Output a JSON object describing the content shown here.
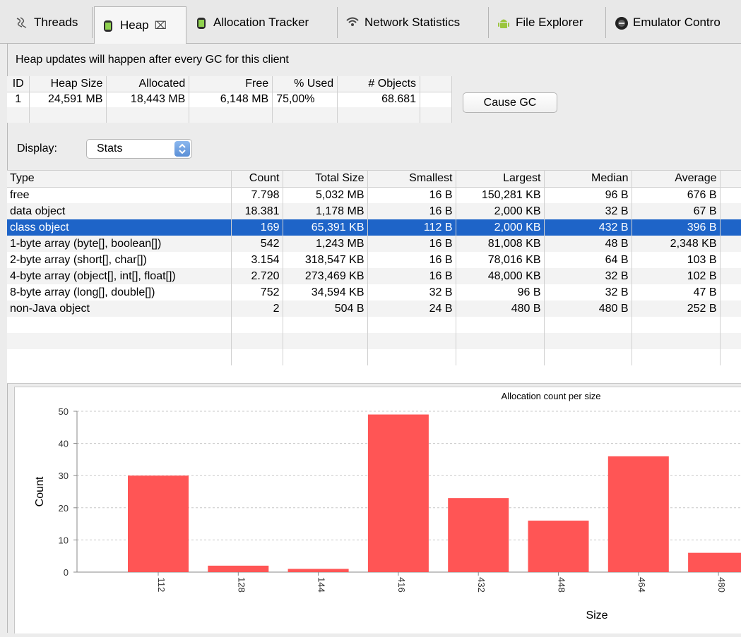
{
  "tabs": [
    {
      "label": "Threads",
      "icon": "threads-icon"
    },
    {
      "label": "Heap",
      "icon": "database-icon",
      "close": "⌧"
    },
    {
      "label": "Allocation Tracker",
      "icon": "database-icon"
    },
    {
      "label": "Network Statistics",
      "icon": "wifi-icon"
    },
    {
      "label": "File Explorer",
      "icon": "android-icon"
    },
    {
      "label": "Emulator Contro",
      "icon": "emulator-icon"
    }
  ],
  "heap": {
    "notice": "Heap updates will happen after every GC for this client",
    "columns": [
      "ID",
      "Heap Size",
      "Allocated",
      "Free",
      "% Used",
      "# Objects"
    ],
    "rows": [
      [
        "1",
        "24,591 MB",
        "18,443 MB",
        "6,148 MB",
        "75,00%",
        "68.681"
      ]
    ],
    "cause_gc": "Cause GC"
  },
  "display": {
    "label": "Display:",
    "selected": "Stats"
  },
  "stats": {
    "columns": [
      "Type",
      "Count",
      "Total Size",
      "Smallest",
      "Largest",
      "Median",
      "Average"
    ],
    "rows": [
      [
        "free",
        "7.798",
        "5,032 MB",
        "16 B",
        "150,281 KB",
        "96 B",
        "676 B"
      ],
      [
        "data object",
        "18.381",
        "1,178 MB",
        "16 B",
        "2,000 KB",
        "32 B",
        "67 B"
      ],
      [
        "class object",
        "169",
        "65,391 KB",
        "112 B",
        "2,000 KB",
        "432 B",
        "396 B"
      ],
      [
        "1-byte array (byte[], boolean[])",
        "542",
        "1,243 MB",
        "16 B",
        "81,008 KB",
        "48 B",
        "2,348 KB"
      ],
      [
        "2-byte array (short[], char[])",
        "3.154",
        "318,547 KB",
        "16 B",
        "78,016 KB",
        "64 B",
        "103 B"
      ],
      [
        "4-byte array (object[], int[], float[])",
        "2.720",
        "273,469 KB",
        "16 B",
        "48,000 KB",
        "32 B",
        "102 B"
      ],
      [
        "8-byte array (long[], double[])",
        "752",
        "34,594 KB",
        "32 B",
        "96 B",
        "32 B",
        "47 B"
      ],
      [
        "non-Java object",
        "2",
        "504 B",
        "24 B",
        "480 B",
        "480 B",
        "252 B"
      ]
    ],
    "selected_row": 2
  },
  "colors": {
    "bar": "#ff5555",
    "selection": "#1e64c8"
  },
  "chart_data": {
    "type": "bar",
    "title": "Allocation count per size",
    "xlabel": "Size",
    "ylabel": "Count",
    "categories": [
      "112",
      "128",
      "144",
      "416",
      "432",
      "448",
      "464",
      "480"
    ],
    "values": [
      30,
      2,
      1,
      49,
      23,
      16,
      36,
      6
    ],
    "ylim": [
      0,
      50
    ],
    "yticks": [
      "0",
      "10",
      "20",
      "30",
      "40",
      "50"
    ],
    "grid": true
  }
}
